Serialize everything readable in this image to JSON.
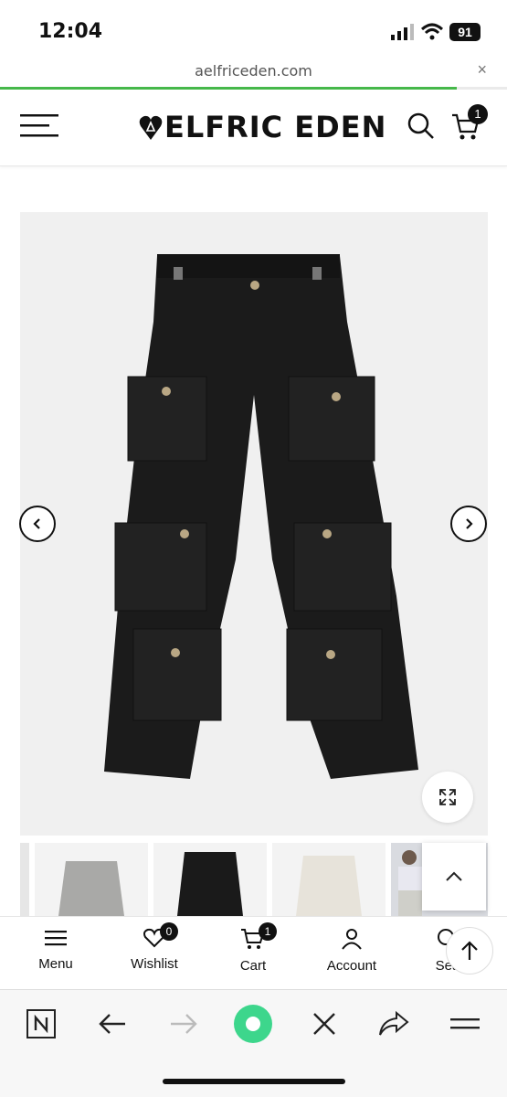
{
  "status_bar": {
    "time": "12:04",
    "battery": "91"
  },
  "browser": {
    "url": "aelfriceden.com",
    "close": "×",
    "load_progress": 0.9
  },
  "header": {
    "brand": "ELFRIC EDEN",
    "cart_count": "1"
  },
  "product_gallery": {
    "images": [
      "black cargo pants"
    ],
    "thumbnails": [
      "grey cargo pants",
      "black cargo pants",
      "white cargo pants",
      "model wearing cargo pants"
    ]
  },
  "bottom_nav": {
    "items": [
      {
        "label": "Menu",
        "icon": "menu-icon"
      },
      {
        "label": "Wishlist",
        "icon": "heart-icon",
        "badge": "0"
      },
      {
        "label": "Cart",
        "icon": "cart-icon",
        "badge": "1"
      },
      {
        "label": "Account",
        "icon": "user-icon"
      },
      {
        "label": "Sea",
        "icon": "search-icon"
      }
    ]
  },
  "colors": {
    "progress": "#46b84a",
    "accent": "#111111",
    "scan_button": "#3dd68c"
  }
}
